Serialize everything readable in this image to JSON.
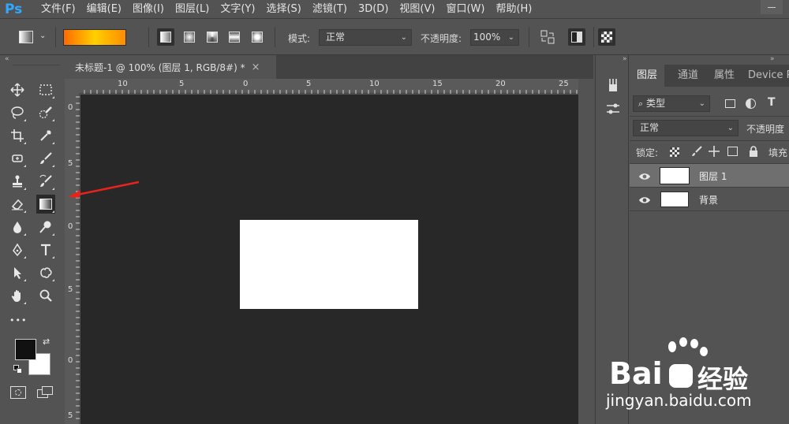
{
  "app": {
    "logo": "Ps"
  },
  "menu": [
    "文件(F)",
    "编辑(E)",
    "图像(I)",
    "图层(L)",
    "文字(Y)",
    "选择(S)",
    "滤镜(T)",
    "3D(D)",
    "视图(V)",
    "窗口(W)",
    "帮助(H)"
  ],
  "options": {
    "mode_label": "模式:",
    "mode_value": "正常",
    "opacity_label": "不透明度:",
    "opacity_value": "100%",
    "gradient_colors": [
      "#ff6a00",
      "#ffd000",
      "#ff8c00"
    ]
  },
  "toolbar": {
    "collapse": "«",
    "more": "•••"
  },
  "document": {
    "tab_title": "未标题-1 @ 100% (图层 1, RGB/8#) *",
    "close": "×"
  },
  "rulers": {
    "h_ticks": [
      "10",
      "5",
      "0",
      "5",
      "10",
      "15",
      "20",
      "25"
    ],
    "v_ticks": [
      "0",
      "5",
      "0",
      "5",
      "0",
      "5"
    ]
  },
  "colors": {
    "foreground": "#111111",
    "background": "#ffffff",
    "canvas": "#282828"
  },
  "panel": {
    "collapse": "»",
    "tabs": [
      "图层",
      "通道",
      "属性",
      "Device Pr"
    ],
    "filter_value": "类型",
    "blend_value": "正常",
    "opacity_label": "不透明度",
    "lock_label": "锁定:",
    "fill_label": "填充",
    "layers": [
      {
        "name": "图层 1",
        "selected": true
      },
      {
        "name": "背景",
        "selected": false
      }
    ]
  },
  "watermark": {
    "brand": "Bai",
    "brand_cn": "经验",
    "url": "jingyan.baidu.com"
  }
}
